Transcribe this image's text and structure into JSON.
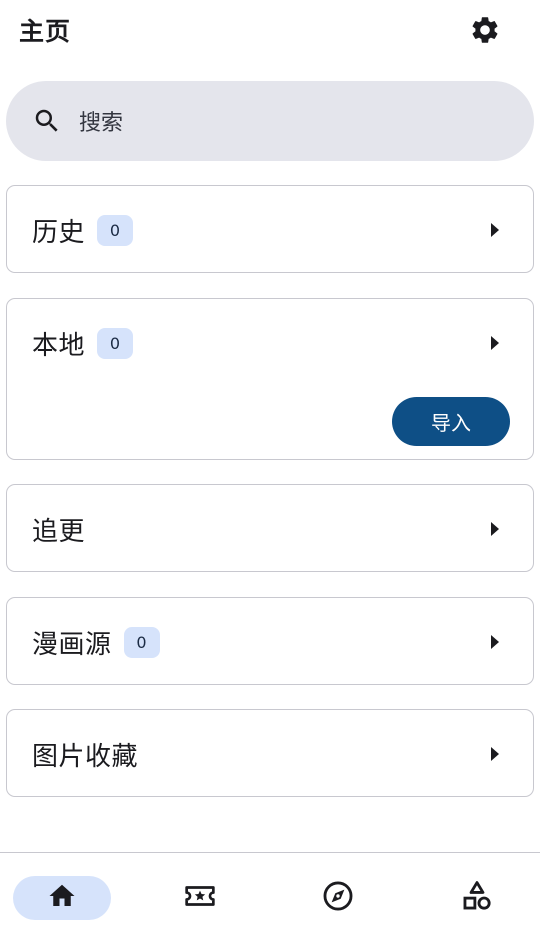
{
  "header": {
    "title": "主页",
    "settings_icon": "gear-icon"
  },
  "search": {
    "placeholder": "搜索",
    "icon": "search-icon"
  },
  "cards": {
    "history": {
      "label": "历史",
      "count": "0"
    },
    "local": {
      "label": "本地",
      "count": "0",
      "import_label": "导入"
    },
    "follow": {
      "label": "追更"
    },
    "sources": {
      "label": "漫画源",
      "count": "0"
    },
    "images": {
      "label": "图片收藏"
    }
  },
  "bottom_nav": {
    "items": [
      {
        "icon": "home-icon",
        "active": true
      },
      {
        "icon": "ticket-star-icon",
        "active": false
      },
      {
        "icon": "compass-icon",
        "active": false
      },
      {
        "icon": "shapes-icon",
        "active": false
      }
    ]
  },
  "colors": {
    "accent": "#0e4f86",
    "badge_bg": "#d6e3fb",
    "search_bg": "#e4e5ec",
    "border": "#c8c8cf"
  }
}
